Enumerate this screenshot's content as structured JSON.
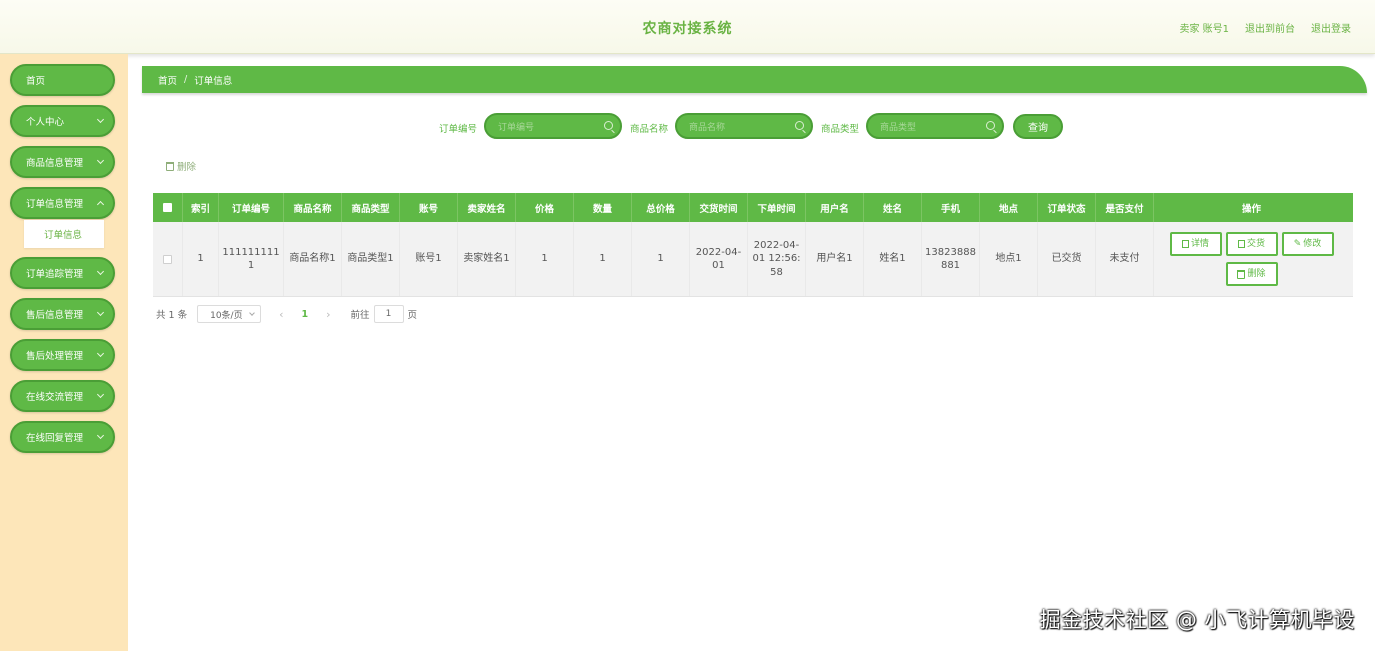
{
  "header": {
    "title": "农商对接系统",
    "links": [
      "卖家 账号1",
      "退出到前台",
      "退出登录"
    ]
  },
  "sidebar": {
    "items": [
      {
        "label": "首页",
        "has_children": false
      },
      {
        "label": "个人中心",
        "has_children": true
      },
      {
        "label": "商品信息管理",
        "has_children": true
      },
      {
        "label": "订单信息管理",
        "has_children": true
      },
      {
        "label": "订单追踪管理",
        "has_children": true
      },
      {
        "label": "售后信息管理",
        "has_children": true
      },
      {
        "label": "售后处理管理",
        "has_children": true
      },
      {
        "label": "在线交流管理",
        "has_children": true
      },
      {
        "label": "在线回复管理",
        "has_children": true
      }
    ],
    "submenu_active": "订单信息"
  },
  "breadcrumb": {
    "home": "首页",
    "separator": "/",
    "current": "订单信息"
  },
  "search": {
    "fields": [
      {
        "label": "订单编号",
        "placeholder": "订单编号"
      },
      {
        "label": "商品名称",
        "placeholder": "商品名称"
      },
      {
        "label": "商品类型",
        "placeholder": "商品类型"
      }
    ],
    "query_label": "查询"
  },
  "toolbar": {
    "delete_label": "删除"
  },
  "table": {
    "columns": [
      "索引",
      "订单编号",
      "商品名称",
      "商品类型",
      "账号",
      "卖家姓名",
      "价格",
      "数量",
      "总价格",
      "交货时间",
      "下单时间",
      "用户名",
      "姓名",
      "手机",
      "地点",
      "订单状态",
      "是否支付",
      "操作"
    ],
    "rows": [
      {
        "cells": [
          "1",
          "1111111111",
          "商品名称1",
          "商品类型1",
          "账号1",
          "卖家姓名1",
          "1",
          "1",
          "1",
          "2022-04-01",
          "2022-04-01 12:56:58",
          "用户名1",
          "姓名1",
          "13823888881",
          "地点1",
          "已交货",
          "未支付"
        ],
        "actions": [
          "详情",
          "交货",
          "修改",
          "删除"
        ]
      }
    ]
  },
  "pagination": {
    "total_text": "共 1 条",
    "page_size": "10条/页",
    "current_page": "1",
    "goto_prefix": "前往",
    "goto_value": "1",
    "goto_suffix": "页"
  },
  "watermark": "掘金技术社区 @ 小飞计算机毕设",
  "colors": {
    "primary": "#5fb946",
    "sidebar_bg": "#fde6b9",
    "header_bg": "#f7f8e9"
  }
}
